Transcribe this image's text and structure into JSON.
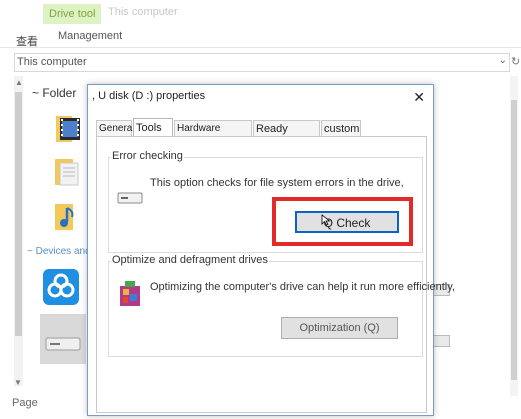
{
  "ribbon": {
    "context_tab": "Drive tool",
    "computer_tab": "This computer",
    "left_label": "查看",
    "manage_tab": "Management"
  },
  "address": {
    "text": "This computer"
  },
  "nav": {
    "folder_heading": "~ Folder",
    "devices_heading": "~ Devices and"
  },
  "status": {
    "page_label": "Page"
  },
  "dialog": {
    "title": ", U disk (D :) properties",
    "close_glyph": "✕",
    "tabs": [
      {
        "label": "General"
      },
      {
        "label": "Tools"
      },
      {
        "label": "Hardware sharing"
      },
      {
        "label": "Ready Boost"
      },
      {
        "label": "custom"
      }
    ],
    "active_tab": "Tools",
    "error_checking": {
      "heading": "Error checking",
      "description": "This option checks for file system errors in the drive,",
      "button_label": "Q Check"
    },
    "optimize": {
      "heading": "Optimize and defragment drives",
      "description": "Optimizing the computer's drive can help it run more efficiently,",
      "button_label": "Optimization (Q)"
    }
  },
  "colors": {
    "highlight": "#e32a2a",
    "context_tab_bg": "#dff2c4",
    "dialog_border": "#7a9cc6",
    "focus_border": "#0a64c8"
  }
}
